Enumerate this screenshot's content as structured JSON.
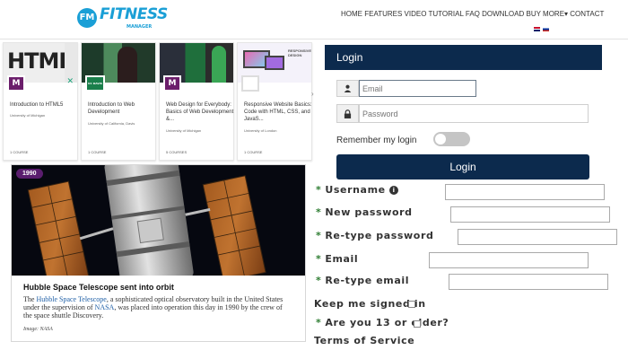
{
  "header": {
    "logo_badge": "FM",
    "logo_text": "FITNESS",
    "logo_sub": "MANAGER",
    "nav": [
      "HOME",
      "FEATURES",
      "VIDEO TUTORIAL",
      "FAQ",
      "DOWNLOAD",
      "BUY",
      "MORE",
      "CONTACT"
    ],
    "more_marker": "▾"
  },
  "cards": [
    {
      "title": "Introduction to HTML5",
      "university": "University of Michigan",
      "count": "1 COURSE",
      "logo": "M",
      "logo_color": "#6b1e6b"
    },
    {
      "title": "Introduction to Web Development",
      "university": "University of California, Davis",
      "count": "1 COURSE",
      "logo": "UCDAVIS",
      "logo_color": "#1a7f4b"
    },
    {
      "title": "Web Design for Everybody: Basics of Web Development &...",
      "university": "University of Michigan",
      "count": "5 COURSES",
      "logo": "M",
      "logo_color": "#6b1e6b"
    },
    {
      "title": "Responsive Website Basics: Code with HTML, CSS, and JavaS...",
      "university": "University of London",
      "count": "1 COURSE",
      "logo": "",
      "logo_color": "#ffffff"
    }
  ],
  "card_image_text": {
    "html": "HTML",
    "responsive": "RESPONSIVE DESIGN"
  },
  "arrow": "›",
  "article": {
    "year": "1990",
    "title": "Hubble Space Telescope sent into orbit",
    "body_before": "The ",
    "link1": "Hubble Space Telescope",
    "body_mid": ", a sophisticated optical observatory built in the United States under the supervision of ",
    "link2": "NASA",
    "body_after": ", was placed into operation this day in 1990 by the crew of the space shuttle Discovery.",
    "credit": "Image: NASA"
  },
  "login": {
    "title": "Login",
    "email_placeholder": "Email",
    "password_placeholder": "Password",
    "remember": "Remember my login",
    "button": "Login"
  },
  "register": {
    "username": "Username",
    "info_icon": "i",
    "new_password": "New password",
    "retype_password": "Re-type password",
    "email": "Email",
    "retype_email": "Re-type email",
    "keep_signed": "Keep me signed in",
    "age": "Are you 13 or older?",
    "tos": "Terms of Service",
    "star": "*"
  },
  "colors": {
    "brand": "#1a9fd6",
    "login_navy": "#0c2a4d",
    "required_star": "#2e7d32",
    "year_badge": "#5a1d6e"
  }
}
